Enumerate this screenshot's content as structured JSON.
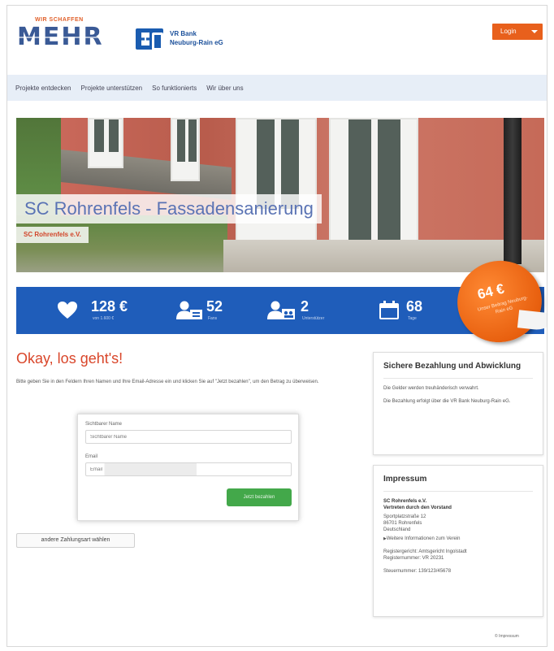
{
  "header": {
    "brand_tagline": "WIR SCHAFFEN",
    "brand_word": "MEHR",
    "bank_name_line1": "VR Bank",
    "bank_name_line2": "Neuburg-Rain eG",
    "login_label": "Login"
  },
  "nav": {
    "items": [
      {
        "label": "Projekte entdecken"
      },
      {
        "label": "Projekte unterstützen"
      },
      {
        "label": "So funktionierts"
      },
      {
        "label": "Wir über uns"
      }
    ]
  },
  "project": {
    "title": "SC Rohrenfels - Fassadensanierung",
    "organization": "SC Rohrenfels e.V."
  },
  "stats": {
    "amount": {
      "value": "128 €",
      "label": "von 1.600 €",
      "icon": "heart-icon"
    },
    "supporters": {
      "value": "52",
      "label": "Fans",
      "icon": "person-id-icon"
    },
    "donors": {
      "value": "2",
      "label": "Unterstützer",
      "icon": "person-group-icon"
    },
    "days": {
      "value": "68",
      "label": "Tage",
      "icon": "calendar-icon"
    }
  },
  "badge": {
    "value": "64 €",
    "text": "Unser Beitrag Neuburg-Rain eG"
  },
  "checkout": {
    "title": "Okay, los geht's!",
    "intro": "Bitte geben Sie in den Feldern Ihren Namen und Ihre Email-Adresse ein und klicken Sie auf \"Jetzt bezahlen\", um den Betrag zu überweisen.",
    "name_label": "Sichtbarer Name",
    "name_value": "Sichtbarer Name",
    "email_label": "Email",
    "email_value": "Email",
    "submit_label": "Jetzt bezahlen",
    "alt_payment_label": "andere Zahlungsart wählen"
  },
  "sidebar": {
    "secure": {
      "title": "Sichere Bezahlung und Abwicklung",
      "p1": "Die Gelder werden treuhänderisch verwahrt.",
      "p2": "Die Bezahlung erfolgt über die VR Bank Neuburg-Rain eG."
    },
    "imprint": {
      "title": "Impressum",
      "org": "SC Rohrenfels e.V.",
      "rep": "Vertreten durch den Vorstand",
      "street": "Sportplatzstraße 12",
      "city": "86701 Rohrenfels",
      "country": "Deutschland",
      "link": "Weitere Informationen zum Verein",
      "court": "Registergericht: Amtsgericht Ingolstadt",
      "reg": "Registernummer: VR 20231",
      "tax": "Steuernummer: 139/123/45678"
    }
  },
  "footer": {
    "link": "© Impressum"
  }
}
